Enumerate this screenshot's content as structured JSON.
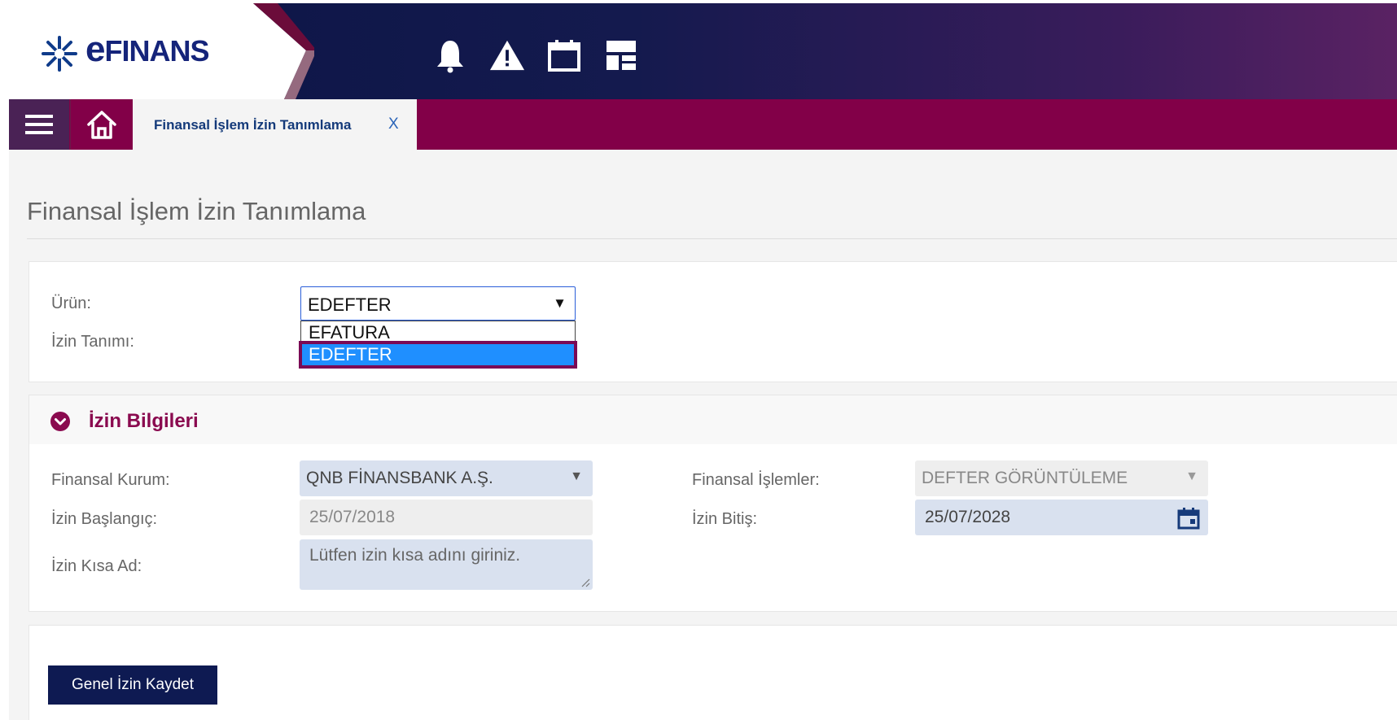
{
  "brand": {
    "logo_text_large": "e",
    "logo_text_rest": "FINANS",
    "accent_color": "#820048",
    "header_color": "#0b1445"
  },
  "header_icons": [
    "bell-icon",
    "warning-icon",
    "calendar-icon",
    "dashboard-icon"
  ],
  "tab": {
    "label": "Finansal İşlem İzin Tanımlama",
    "close_label": "X"
  },
  "page": {
    "title": "Finansal İşlem İzin Tanımlama"
  },
  "form1": {
    "urun_label": "Ürün:",
    "izin_tanimi_label": "İzin Tanımı:",
    "urun_value": "EDEFTER",
    "urun_arrow": "▼",
    "options": [
      "EFATURA",
      "EDEFTER"
    ],
    "selected_option": "EDEFTER"
  },
  "section": {
    "title": "İzin Bilgileri"
  },
  "form2": {
    "finansal_kurum_label": "Finansal Kurum:",
    "finansal_kurum_value": "QNB FİNANSBANK A.Ş.",
    "finansal_islemler_label": "Finansal İşlemler:",
    "finansal_islemler_value": "DEFTER GÖRÜNTÜLEME",
    "izin_baslangic_label": "İzin Başlangıç:",
    "izin_baslangic_value": "25/07/2018",
    "izin_bitis_label": "İzin Bitiş:",
    "izin_bitis_value": "25/07/2028",
    "izin_kisa_ad_label": "İzin Kısa Ad:",
    "izin_kisa_ad_placeholder": "Lütfen izin kısa adını giriniz.",
    "arrow": "▼"
  },
  "actions": {
    "save_label": "Genel İzin Kaydet"
  }
}
